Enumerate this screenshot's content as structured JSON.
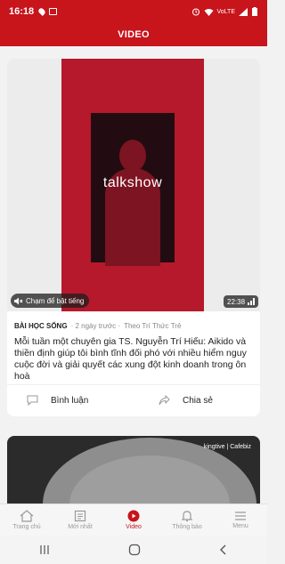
{
  "status_bar": {
    "time": "16:18",
    "network": "VoLTE"
  },
  "app_bar": {
    "title": "VIDEO"
  },
  "feed": {
    "card": {
      "poster_text": "talkshow",
      "mute_label": "Chạm để bật tiếng",
      "duration": "22:38",
      "category": "BÀI HỌC SỐNG",
      "time_ago": "· 2 ngày trước ·",
      "source": "Theo Trí Thức Trẻ",
      "headline": "Mỗi tuần một chuyên gia TS. Nguyễn Trí Hiếu: Aikido và thiền định giúp tôi bình tĩnh đối phó với nhiều hiểm nguy cuộc đời và giải quyết các xung đột kinh doanh trong ôn hoà",
      "comment_label": "Bình luận",
      "share_label": "Chia sẻ"
    },
    "next_card": {
      "logos": "kingtive | Cafebiz"
    }
  },
  "bottom_nav": {
    "items": [
      {
        "label": "Trang chủ",
        "icon": "home-icon"
      },
      {
        "label": "Mới nhất",
        "icon": "newspaper-icon"
      },
      {
        "label": "Video",
        "icon": "play-circle-icon"
      },
      {
        "label": "Thông báo",
        "icon": "bell-icon"
      },
      {
        "label": "Menu",
        "icon": "hamburger-icon"
      }
    ],
    "active_index": 2
  },
  "colors": {
    "brand": "#c8141b",
    "poster": "#b5192b"
  }
}
